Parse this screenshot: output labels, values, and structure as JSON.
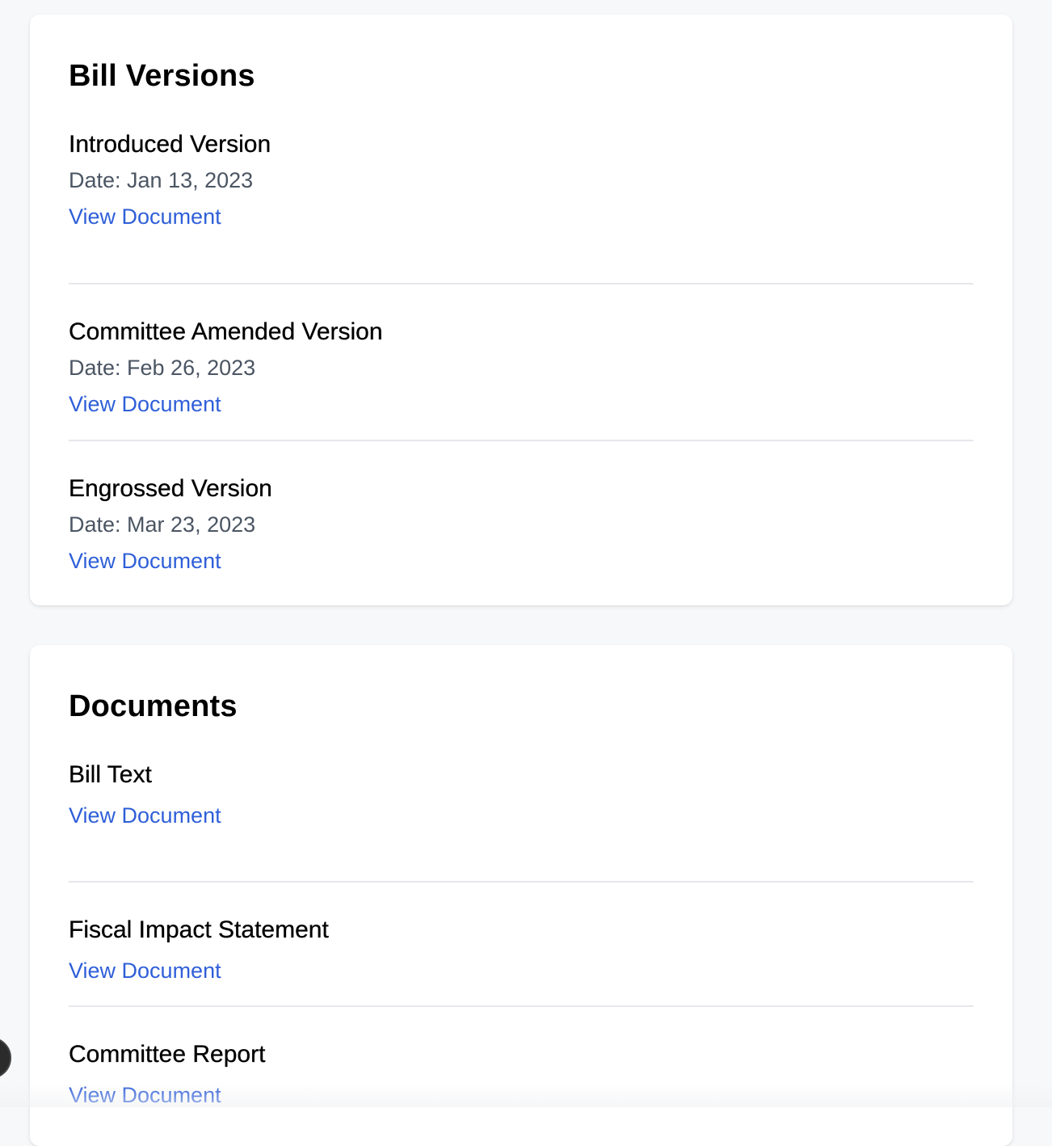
{
  "bill_versions": {
    "title": "Bill Versions",
    "items": [
      {
        "name": "Introduced Version",
        "date": "Date: Jan 13, 2023",
        "link_label": "View Document"
      },
      {
        "name": "Committee Amended Version",
        "date": "Date: Feb 26, 2023",
        "link_label": "View Document"
      },
      {
        "name": "Engrossed Version",
        "date": "Date: Mar 23, 2023",
        "link_label": "View Document"
      }
    ]
  },
  "documents": {
    "title": "Documents",
    "items": [
      {
        "name": "Bill Text",
        "link_label": "View Document"
      },
      {
        "name": "Fiscal Impact Statement",
        "link_label": "View Document"
      },
      {
        "name": "Committee Report",
        "link_label": "View Document"
      }
    ]
  },
  "colors": {
    "background": "#f7f8fa",
    "card": "#ffffff",
    "link": "#2f5fd8",
    "muted_text": "#4b5563",
    "divider": "#e5e7eb"
  }
}
